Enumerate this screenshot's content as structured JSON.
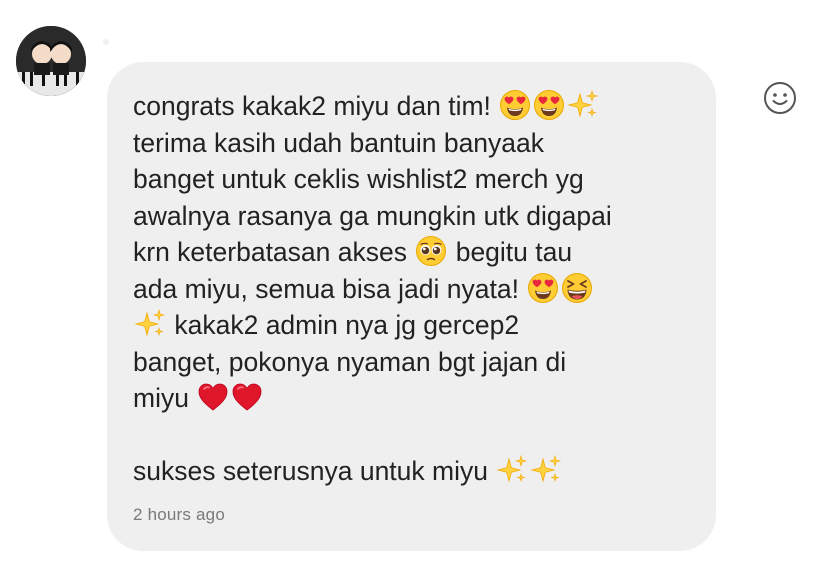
{
  "message": {
    "lines": [
      [
        "congrats kakak2 miyu dan tim! ",
        "heart-eyes",
        "heart-eyes",
        "sparkles"
      ],
      [
        "terima kasih udah bantuin banyaak"
      ],
      [
        "banget untuk ceklis wishlist2 merch yg"
      ],
      [
        "awalnya rasanya ga mungkin utk digapai"
      ],
      [
        "krn keterbatasan akses ",
        "pleading-face",
        " begitu tau"
      ],
      [
        "ada miyu, semua bisa jadi nyata! ",
        "heart-eyes",
        "grinning-squint"
      ],
      [
        "sparkles",
        " kakak2 admin nya jg gercep2"
      ],
      [
        "banget, pokonya nyaman bgt jajan di"
      ],
      [
        "miyu ",
        "red-heart",
        "red-heart"
      ],
      [
        ""
      ],
      [
        "sukses seterusnya untuk miyu ",
        "sparkles",
        "sparkles"
      ]
    ]
  },
  "timestamp": "2 hours ago",
  "reaction_button_icon": "smiley-icon",
  "avatar_icon": "profile-avatar"
}
